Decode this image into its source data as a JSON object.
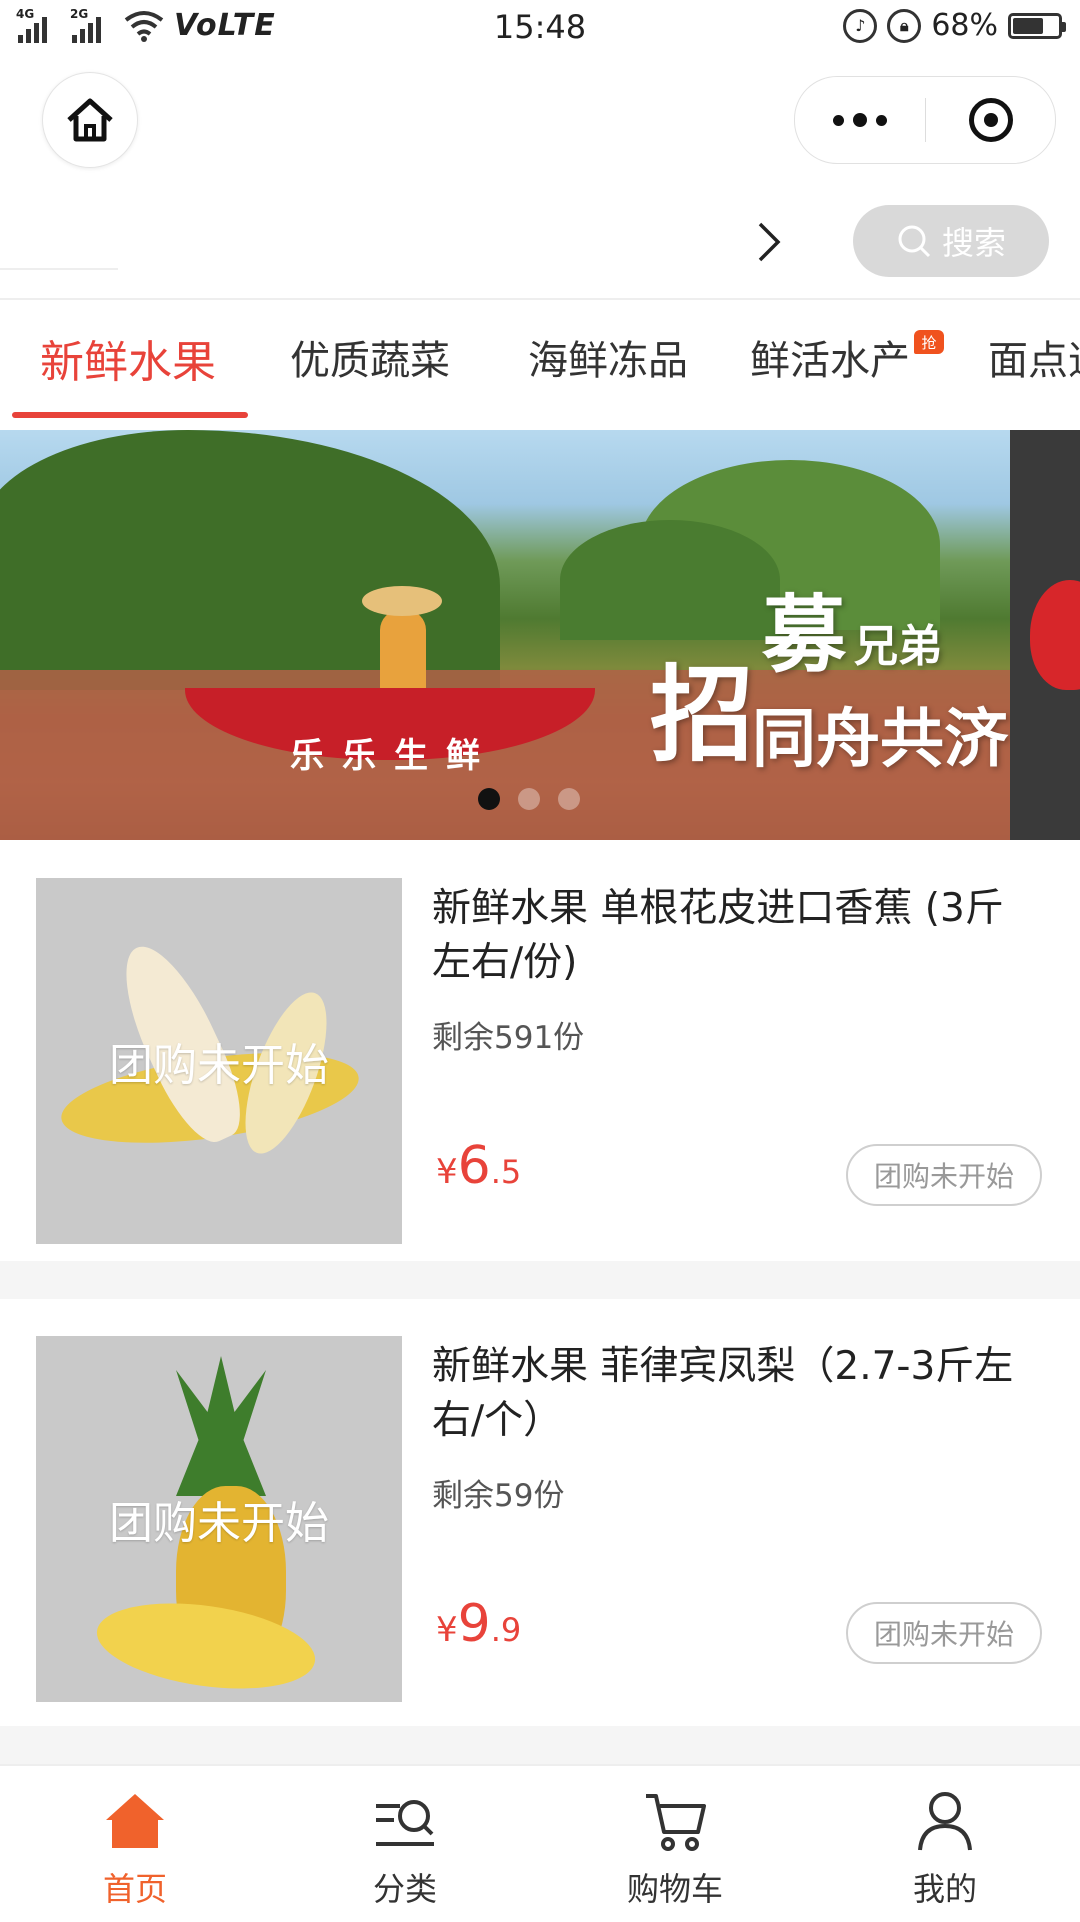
{
  "status_bar": {
    "sim1_label": "4G",
    "sim2_label": "2G",
    "network": "VoLTE",
    "time": "15:48",
    "battery": "68%",
    "battery_level": 0.68
  },
  "nav": {
    "home_icon": "home-icon",
    "more_icon": "more-dots-icon",
    "close_icon": "target-icon"
  },
  "search": {
    "label": "搜索",
    "icon": "search-icon"
  },
  "categories": [
    {
      "label": "新鲜水果",
      "active": true
    },
    {
      "label": "优质蔬菜",
      "active": false
    },
    {
      "label": "海鲜冻品",
      "active": false
    },
    {
      "label": "鲜活水产",
      "active": false,
      "badge": "抢"
    },
    {
      "label": "面点速",
      "active": false
    }
  ],
  "banner": {
    "boat_text": "乐乐生鲜",
    "headline_big": "招",
    "headline_mu": "募",
    "headline_sub1": "兄弟",
    "headline_sub2": "同舟共济",
    "slide_count": 3,
    "active_slide": 1
  },
  "products": [
    {
      "title": "新鲜水果 单根花皮进口香蕉 (3斤左右/份)",
      "overlay": "团购未开始",
      "stock": "剩余591份",
      "currency": "¥",
      "price_int": "6",
      "price_dec": ".5",
      "button": "团购未开始"
    },
    {
      "title": "新鲜水果 菲律宾凤梨（2.7-3斤左右/个）",
      "overlay": "团购未开始",
      "stock": "剩余59份",
      "currency": "¥",
      "price_int": "9",
      "price_dec": ".9",
      "button": "团购未开始"
    }
  ],
  "tabbar": [
    {
      "label": "首页",
      "icon": "home-filled-icon",
      "active": true
    },
    {
      "label": "分类",
      "icon": "category-search-icon",
      "active": false
    },
    {
      "label": "购物车",
      "icon": "cart-icon",
      "active": false
    },
    {
      "label": "我的",
      "icon": "user-icon",
      "active": false
    }
  ],
  "colors": {
    "accent": "#e8433a",
    "tab_active": "#f0622c",
    "search_bg": "#d9d9d9",
    "badge": "#f0521e"
  }
}
